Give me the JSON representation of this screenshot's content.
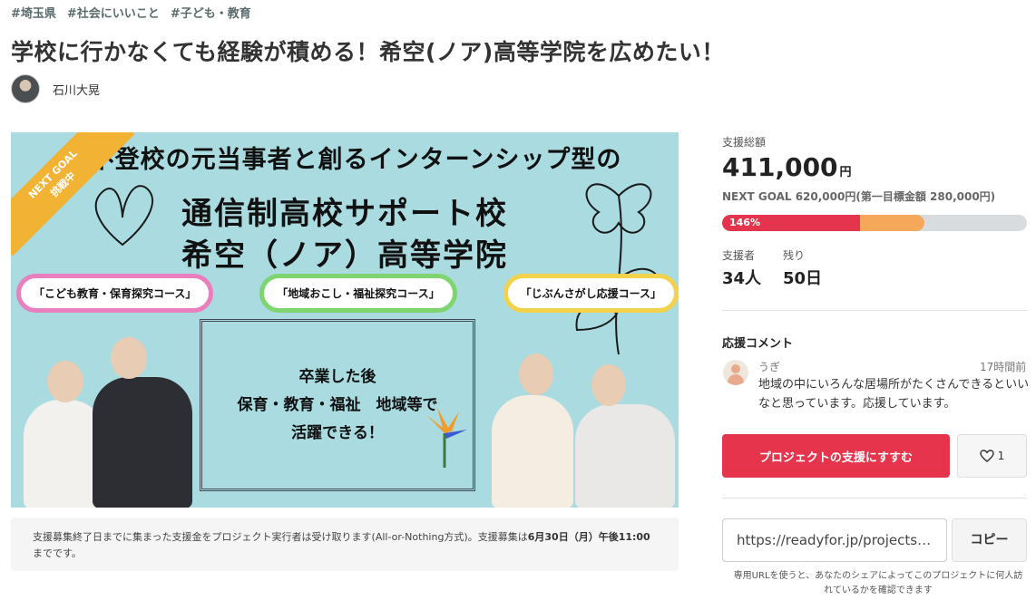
{
  "tags": [
    "#埼玉県",
    "#社会にいいこと",
    "#子ども・教育"
  ],
  "title": "学校に行かなくても経験が積める！希空(ノア)高等学院を広めたい！",
  "author": {
    "name": "石川大晃"
  },
  "hero": {
    "ribbon_line1": "NEXT GOAL",
    "ribbon_line2": "挑戦中",
    "line1": "不登校の元当事者と創るインターンシップ型の",
    "line2": "通信制高校サポート校",
    "line3": "希空（ノア）高等学院",
    "courses": [
      "「こども教育・保育探究コース」",
      "「地域おこし・福祉探究コース」",
      "「じぶんさがし応援コース」"
    ],
    "frame_lines": [
      "卒業した後",
      "保育・教育・福祉　地域等で",
      "活躍できる！"
    ]
  },
  "funding": {
    "total_label": "支援総額",
    "total_amount": "411,000",
    "currency": "円",
    "next_goal_text": "NEXT GOAL 620,000円(第一目標金額 280,000円)",
    "percent_label": "146%",
    "progress_first_goal_fraction": 0.451,
    "progress_next_goal_fraction": 0.663,
    "supporters_label": "支援者",
    "supporters_value": "34人",
    "remaining_label": "残り",
    "remaining_value": "50日",
    "colors": {
      "primary": "#e5344c",
      "secondary": "#f6a85a",
      "track": "#d9dcdf"
    }
  },
  "comments": {
    "title": "応援コメント",
    "items": [
      {
        "user": "うぎ",
        "time": "17時間前",
        "text": "地域の中にいろんな居場所がたくさんできるといいなと思っています。応援しています。"
      }
    ]
  },
  "actions": {
    "support_label": "プロジェクトの支援にすすむ",
    "favorite_count": "1"
  },
  "share": {
    "url": "https://readyfor.jp/projects/...",
    "copy_label": "コピー",
    "note": "専用URLを使うと、あなたのシェアによってこのプロジェクトに何人訪れているかを確認できます"
  },
  "notice": {
    "text_before": "支援募集終了日までに集まった支援金をプロジェクト実行者は受け取ります(All-or-Nothing方式)。支援募集は",
    "deadline": "6月30日（月）午後11:00",
    "text_after": "までです。"
  }
}
